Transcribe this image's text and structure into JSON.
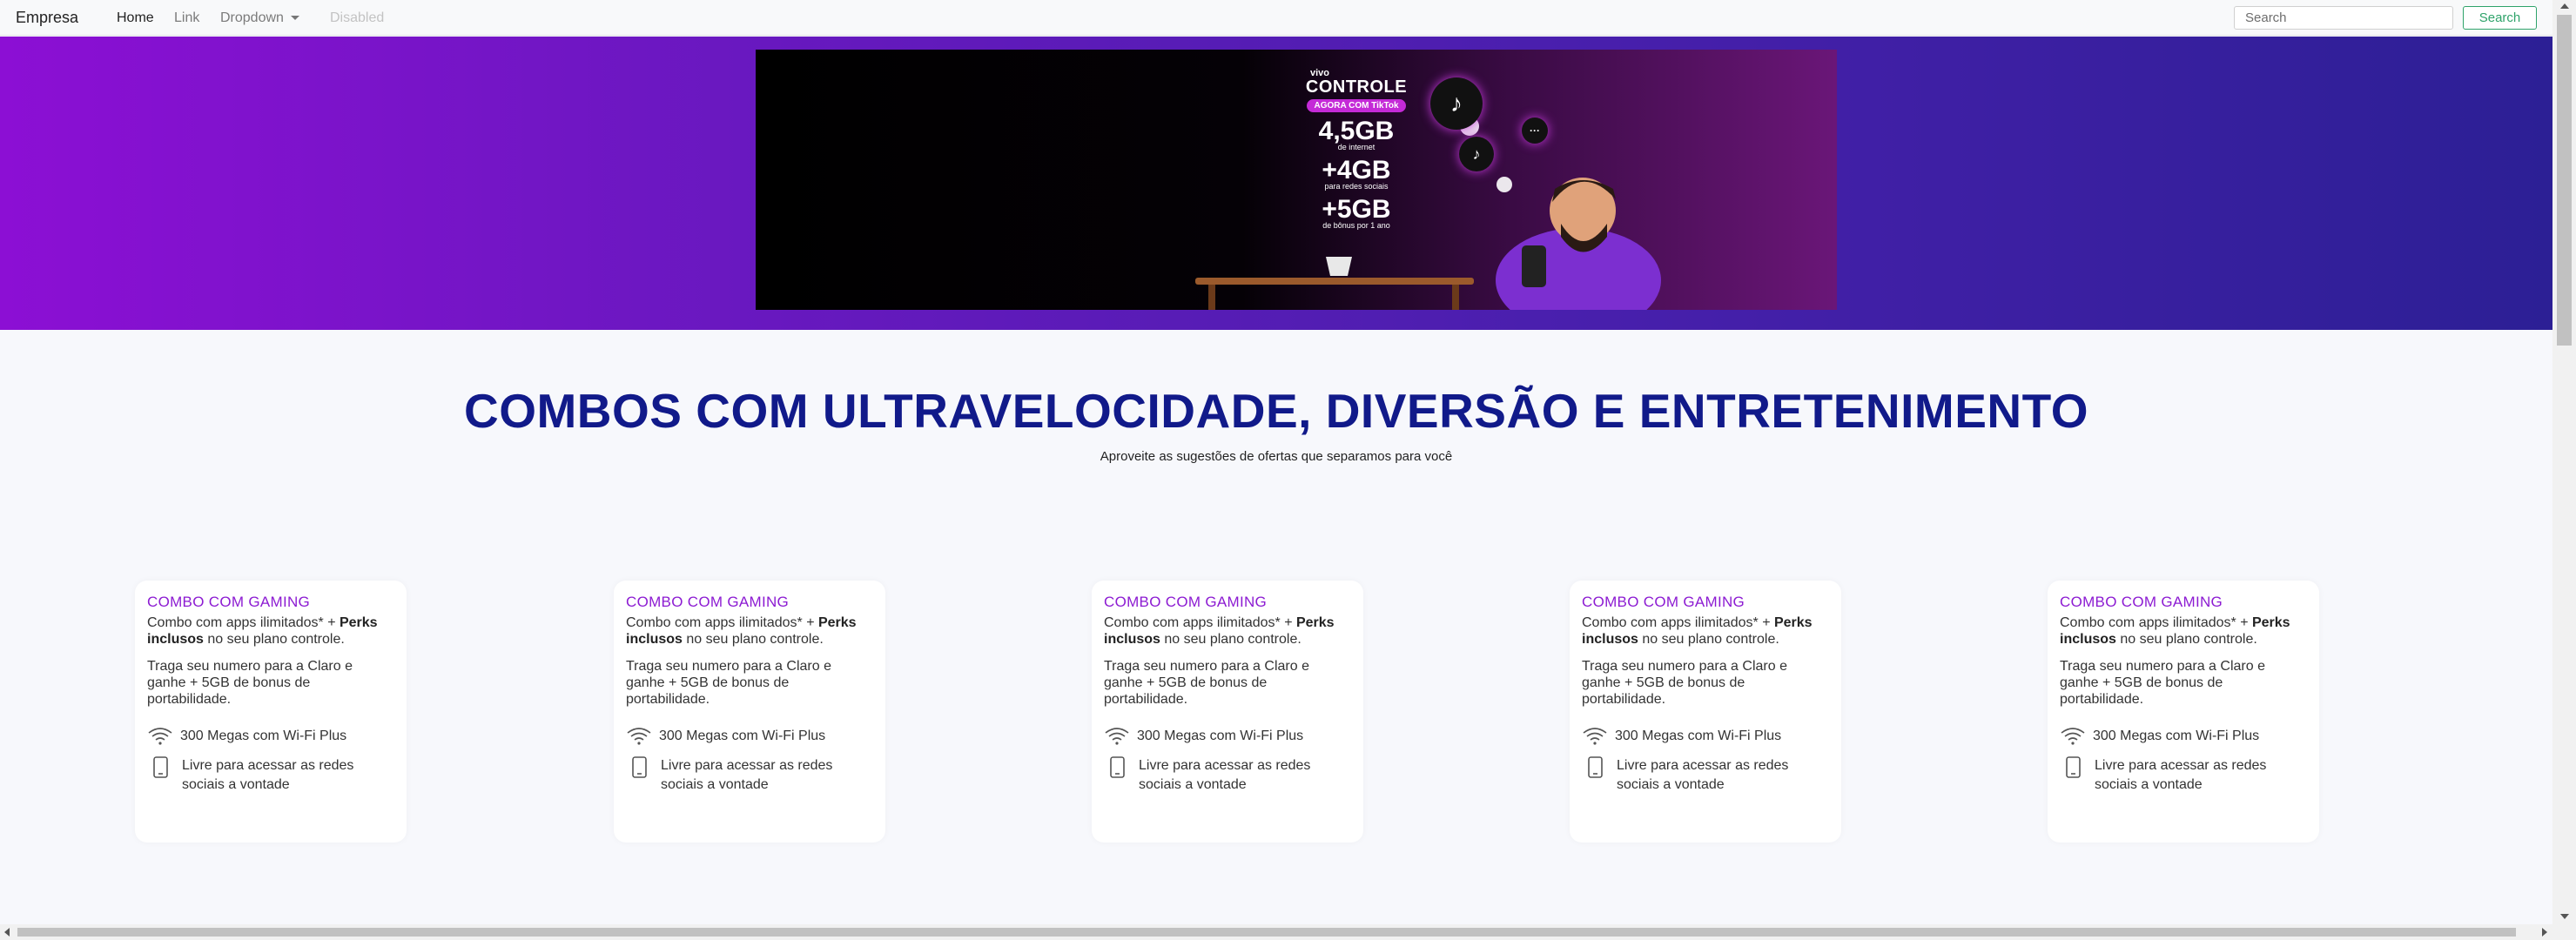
{
  "navbar": {
    "brand": "Empresa",
    "links": [
      {
        "label": "Home"
      },
      {
        "label": "Link"
      },
      {
        "label": "Dropdown"
      },
      {
        "label": "Disabled"
      }
    ],
    "search_placeholder": "Search",
    "search_button": "Search"
  },
  "banner": {
    "brand": "vivo",
    "title": "CONTROLE",
    "pill": "AGORA COM TikTok",
    "line1_value": "4,5GB",
    "line1_label": "de internet",
    "line2_value": "+4GB",
    "line2_label": "para redes sociais",
    "line3_value": "+5GB",
    "line3_label": "de bônus por 1 ano"
  },
  "main": {
    "title": "COMBOS COM ULTRAVELOCIDADE, DIVERSÃO E ENTRETENIMENTO",
    "subtitle": "Aproveite as sugestões de ofertas que separamos para você"
  },
  "cards": [
    {
      "title": "COMBO COM GAMING",
      "desc_pre": "Combo com apps ilimitados* + ",
      "desc_bold": "Perks inclusos",
      "desc_post": " no seu plano controle.",
      "portability": "Traga seu numero para a Claro e ganhe + 5GB de bonus de portabilidade.",
      "feature1": "300 Megas com Wi-Fi Plus",
      "feature2": "Livre para acessar as redes sociais a vontade"
    },
    {
      "title": "COMBO COM GAMING",
      "desc_pre": "Combo com apps ilimitados* + ",
      "desc_bold": "Perks inclusos",
      "desc_post": " no seu plano controle.",
      "portability": "Traga seu numero para a Claro e ganhe + 5GB de bonus de portabilidade.",
      "feature1": "300 Megas com Wi-Fi Plus",
      "feature2": "Livre para acessar as redes sociais a vontade"
    },
    {
      "title": "COMBO COM GAMING",
      "desc_pre": "Combo com apps ilimitados* + ",
      "desc_bold": "Perks inclusos",
      "desc_post": " no seu plano controle.",
      "portability": "Traga seu numero para a Claro e ganhe + 5GB de bonus de portabilidade.",
      "feature1": "300 Megas com Wi-Fi Plus",
      "feature2": "Livre para acessar as redes sociais a vontade"
    },
    {
      "title": "COMBO COM GAMING",
      "desc_pre": "Combo com apps ilimitados* + ",
      "desc_bold": "Perks inclusos",
      "desc_post": " no seu plano controle.",
      "portability": "Traga seu numero para a Claro e ganhe + 5GB de bonus de portabilidade.",
      "feature1": "300 Megas com Wi-Fi Plus",
      "feature2": "Livre para acessar as redes sociais a vontade"
    },
    {
      "title": "COMBO COM GAMING",
      "desc_pre": "Combo com apps ilimitados* + ",
      "desc_bold": "Perks inclusos",
      "desc_post": " no seu plano controle.",
      "portability": "Traga seu numero para a Claro e ganhe + 5GB de bonus de portabilidade.",
      "feature1": "300 Megas com Wi-Fi Plus",
      "feature2": "Livre para acessar as redes sociais a vontade"
    }
  ]
}
